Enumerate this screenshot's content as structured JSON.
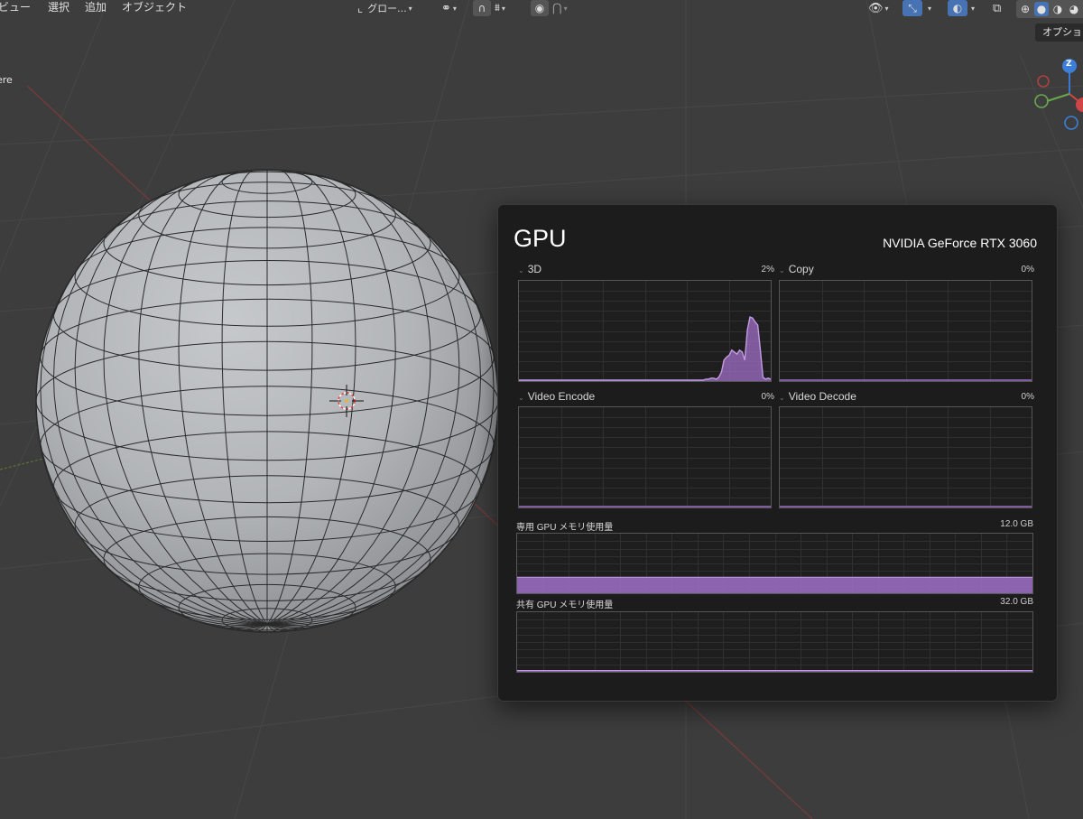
{
  "blender": {
    "menu": [
      "ビュー",
      "選択",
      "追加",
      "オブジェクト"
    ],
    "transform_orientation": "グロー...",
    "options_label": "オプショ",
    "object_label": "ere",
    "gizmo_z_label": "Z"
  },
  "gpu_panel": {
    "title": "GPU",
    "device": "NVIDIA GeForce RTX 3060",
    "accent_color": "#a070c8",
    "engines": [
      {
        "name": "3D",
        "percent": "2%",
        "history": [
          0,
          0,
          0,
          0,
          0,
          0,
          0,
          0,
          0,
          0,
          0,
          0,
          0,
          0,
          0,
          0,
          0,
          0,
          0,
          0,
          0,
          0,
          0,
          0,
          0,
          0,
          0,
          0,
          0,
          0,
          0,
          0,
          0,
          0,
          0,
          0,
          0,
          0,
          0,
          0,
          0,
          0,
          0,
          0,
          0,
          0,
          0,
          0,
          0,
          0,
          0,
          0,
          0,
          0,
          0,
          0,
          0,
          0,
          0,
          0,
          0,
          0,
          0,
          0,
          0,
          0,
          0,
          0,
          0,
          0,
          0,
          0,
          1,
          1,
          2,
          2,
          1,
          3,
          8,
          20,
          23,
          25,
          30,
          28,
          26,
          30,
          28,
          20,
          50,
          63,
          62,
          58,
          55,
          30,
          3,
          1,
          2,
          1
        ]
      },
      {
        "name": "Copy",
        "percent": "0%"
      },
      {
        "name": "Video Encode",
        "percent": "0%"
      },
      {
        "name": "Video Decode",
        "percent": "0%"
      }
    ],
    "dedicated_memory": {
      "label": "専用 GPU メモリ使用量",
      "total": "12.0 GB",
      "used_fraction": 0.27
    },
    "shared_memory": {
      "label": "共有 GPU メモリ使用量",
      "total": "32.0 GB",
      "used_fraction": 0.005
    }
  }
}
